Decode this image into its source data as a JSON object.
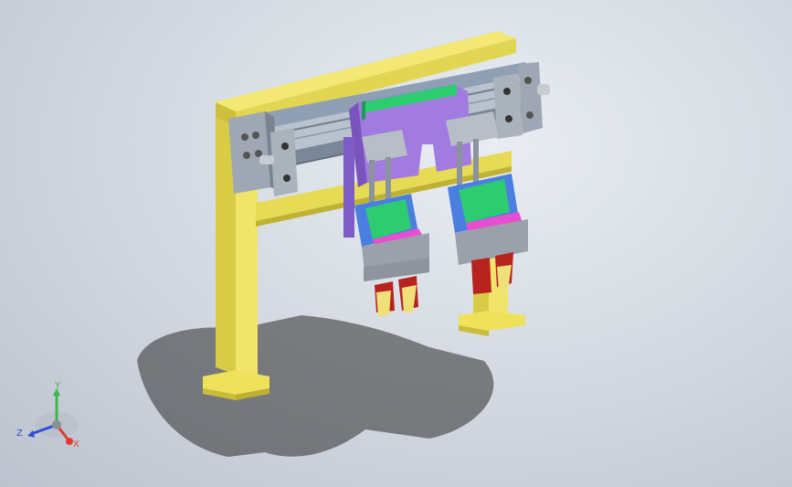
{
  "viewport": {
    "background_top": "#e9edf3",
    "background_bottom": "#bcc3ce"
  },
  "triad": {
    "y_label": "Y",
    "z_label": "Z",
    "x_label": "X",
    "x_color": "#e23a2e",
    "y_color": "#3fb54a",
    "z_color": "#2f4fd8"
  },
  "colors": {
    "frame_yellow": "#f1e46a",
    "frame_shade": "#c9bd3a",
    "carriage_purple": "#a17be0",
    "block_green": "#2ecc71",
    "block_blue": "#4a7fe0",
    "block_magenta": "#e84fd0",
    "jaw_red": "#b7231f",
    "steel": "#9aa1aa"
  }
}
